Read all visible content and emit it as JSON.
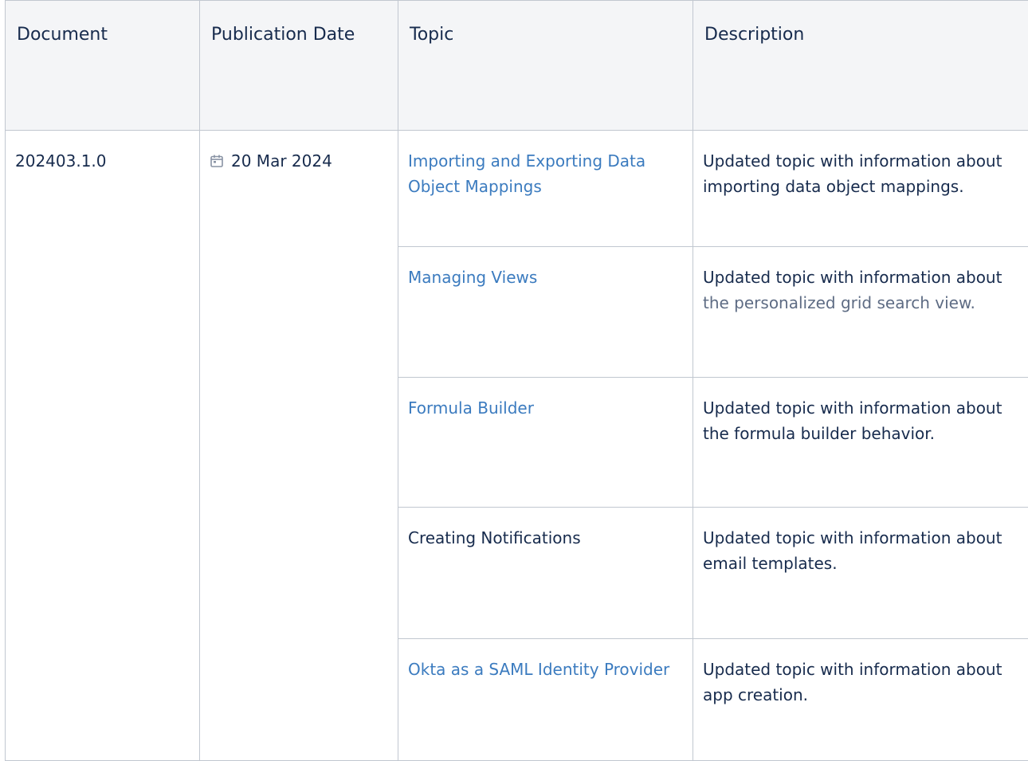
{
  "headers": {
    "document": "Document",
    "publication_date": "Publication Date",
    "topic": "Topic",
    "description": "Description"
  },
  "doc_version": "202403.1.0",
  "publication_date": "20 Mar 2024",
  "date_icon": "calendar-icon",
  "rows": [
    {
      "topic": "Importing and Exporting Data Object Mappings",
      "description": "Updated topic with information about importing data object mappings."
    },
    {
      "topic": "Managing Views",
      "description_intro": "Updated topic with information about ",
      "description_detail": "the personalized grid search view."
    },
    {
      "topic": "Formula Builder",
      "description": "Updated topic with information about the formula builder behavior."
    },
    {
      "topic": "Creating Notifications",
      "description": "Updated topic with information about email templates."
    },
    {
      "topic": "Okta as a SAML Identity Provider",
      "description": "Updated topic with information about app creation."
    }
  ],
  "colors": {
    "link": "#3b7bbf",
    "text": "#172b4d",
    "muted": "#5e6c84",
    "header_bg": "#f4f5f7",
    "border": "#c1c7d0"
  }
}
